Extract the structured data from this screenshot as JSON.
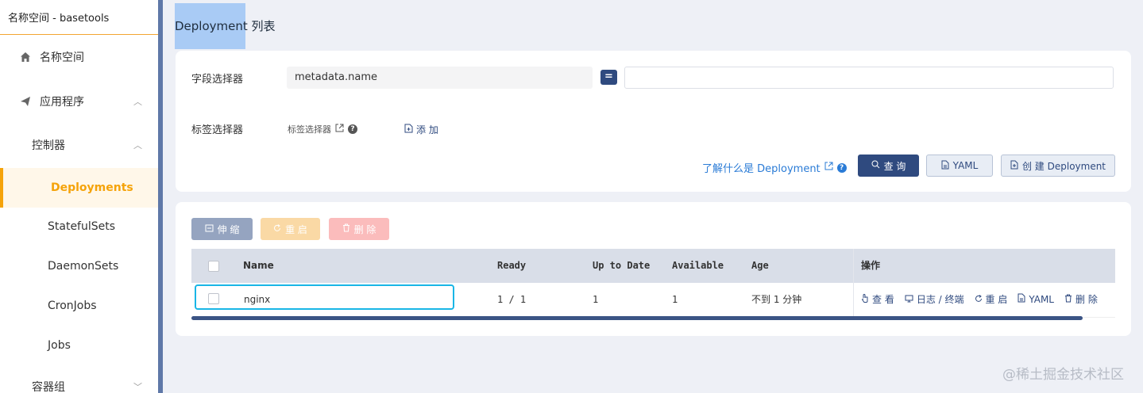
{
  "sidebar": {
    "header": "名称空间 - basetools",
    "items": [
      {
        "label": "名称空间",
        "icon": "home-icon"
      },
      {
        "label": "应用程序",
        "icon": "send-icon"
      },
      {
        "label": "控制器"
      },
      {
        "label": "Deployments"
      },
      {
        "label": "StatefulSets"
      },
      {
        "label": "DaemonSets"
      },
      {
        "label": "CronJobs"
      },
      {
        "label": "Jobs"
      },
      {
        "label": "容器组"
      }
    ]
  },
  "page": {
    "title": "Deployment 列表"
  },
  "filters": {
    "field_selector_label": "字段选择器",
    "field_selector_value": "metadata.name",
    "equals_label": "=",
    "value_input": "",
    "label_selector_label": "标签选择器",
    "label_selector_link": "标签选择器",
    "add_label": "添 加",
    "learn_link": "了解什么是 Deployment",
    "query_label": "查 询",
    "yaml_label": "YAML",
    "create_label": "创 建 Deployment"
  },
  "bulk_actions": {
    "scale_label": "伸 缩",
    "restart_label": "重 启",
    "delete_label": "删 除"
  },
  "table": {
    "columns": [
      "Name",
      "Ready",
      "Up to Date",
      "Available",
      "Age",
      "操作"
    ],
    "rows": [
      {
        "name": "nginx",
        "ready": "1 / 1",
        "up_to_date": "1",
        "available": "1",
        "age": "不到 1 分钟"
      }
    ],
    "row_actions": [
      "查 看",
      "日志 / 终端",
      "重 启",
      "YAML",
      "删 除"
    ]
  },
  "watermark": "@稀土掘金技术社区",
  "colors": {
    "accent": "#f5a30a",
    "primary": "#2f4a7f",
    "link": "#2a7bd6",
    "highlight": "#19b6e6"
  }
}
